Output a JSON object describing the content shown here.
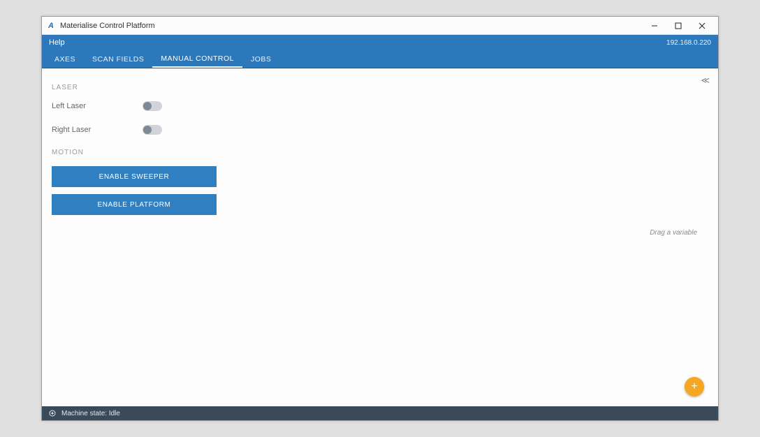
{
  "window": {
    "title": "Materialise Control Platform"
  },
  "menubar": {
    "help": "Help",
    "ip": "192.168.0.220"
  },
  "tabs": [
    {
      "label": "AXES",
      "active": false
    },
    {
      "label": "SCAN FIELDS",
      "active": false
    },
    {
      "label": "MANUAL CONTROL",
      "active": true
    },
    {
      "label": "JOBS",
      "active": false
    }
  ],
  "sections": {
    "laser": {
      "heading": "LASER",
      "left_label": "Left Laser",
      "right_label": "Right Laser",
      "left_on": false,
      "right_on": false
    },
    "motion": {
      "heading": "MOTION",
      "enable_sweeper": "ENABLE SWEEPER",
      "enable_platform": "ENABLE PLATFORM"
    }
  },
  "right_panel": {
    "drag_hint": "Drag a variable"
  },
  "fab": {
    "glyph": "+"
  },
  "status": {
    "text": "Machine state: Idle"
  }
}
